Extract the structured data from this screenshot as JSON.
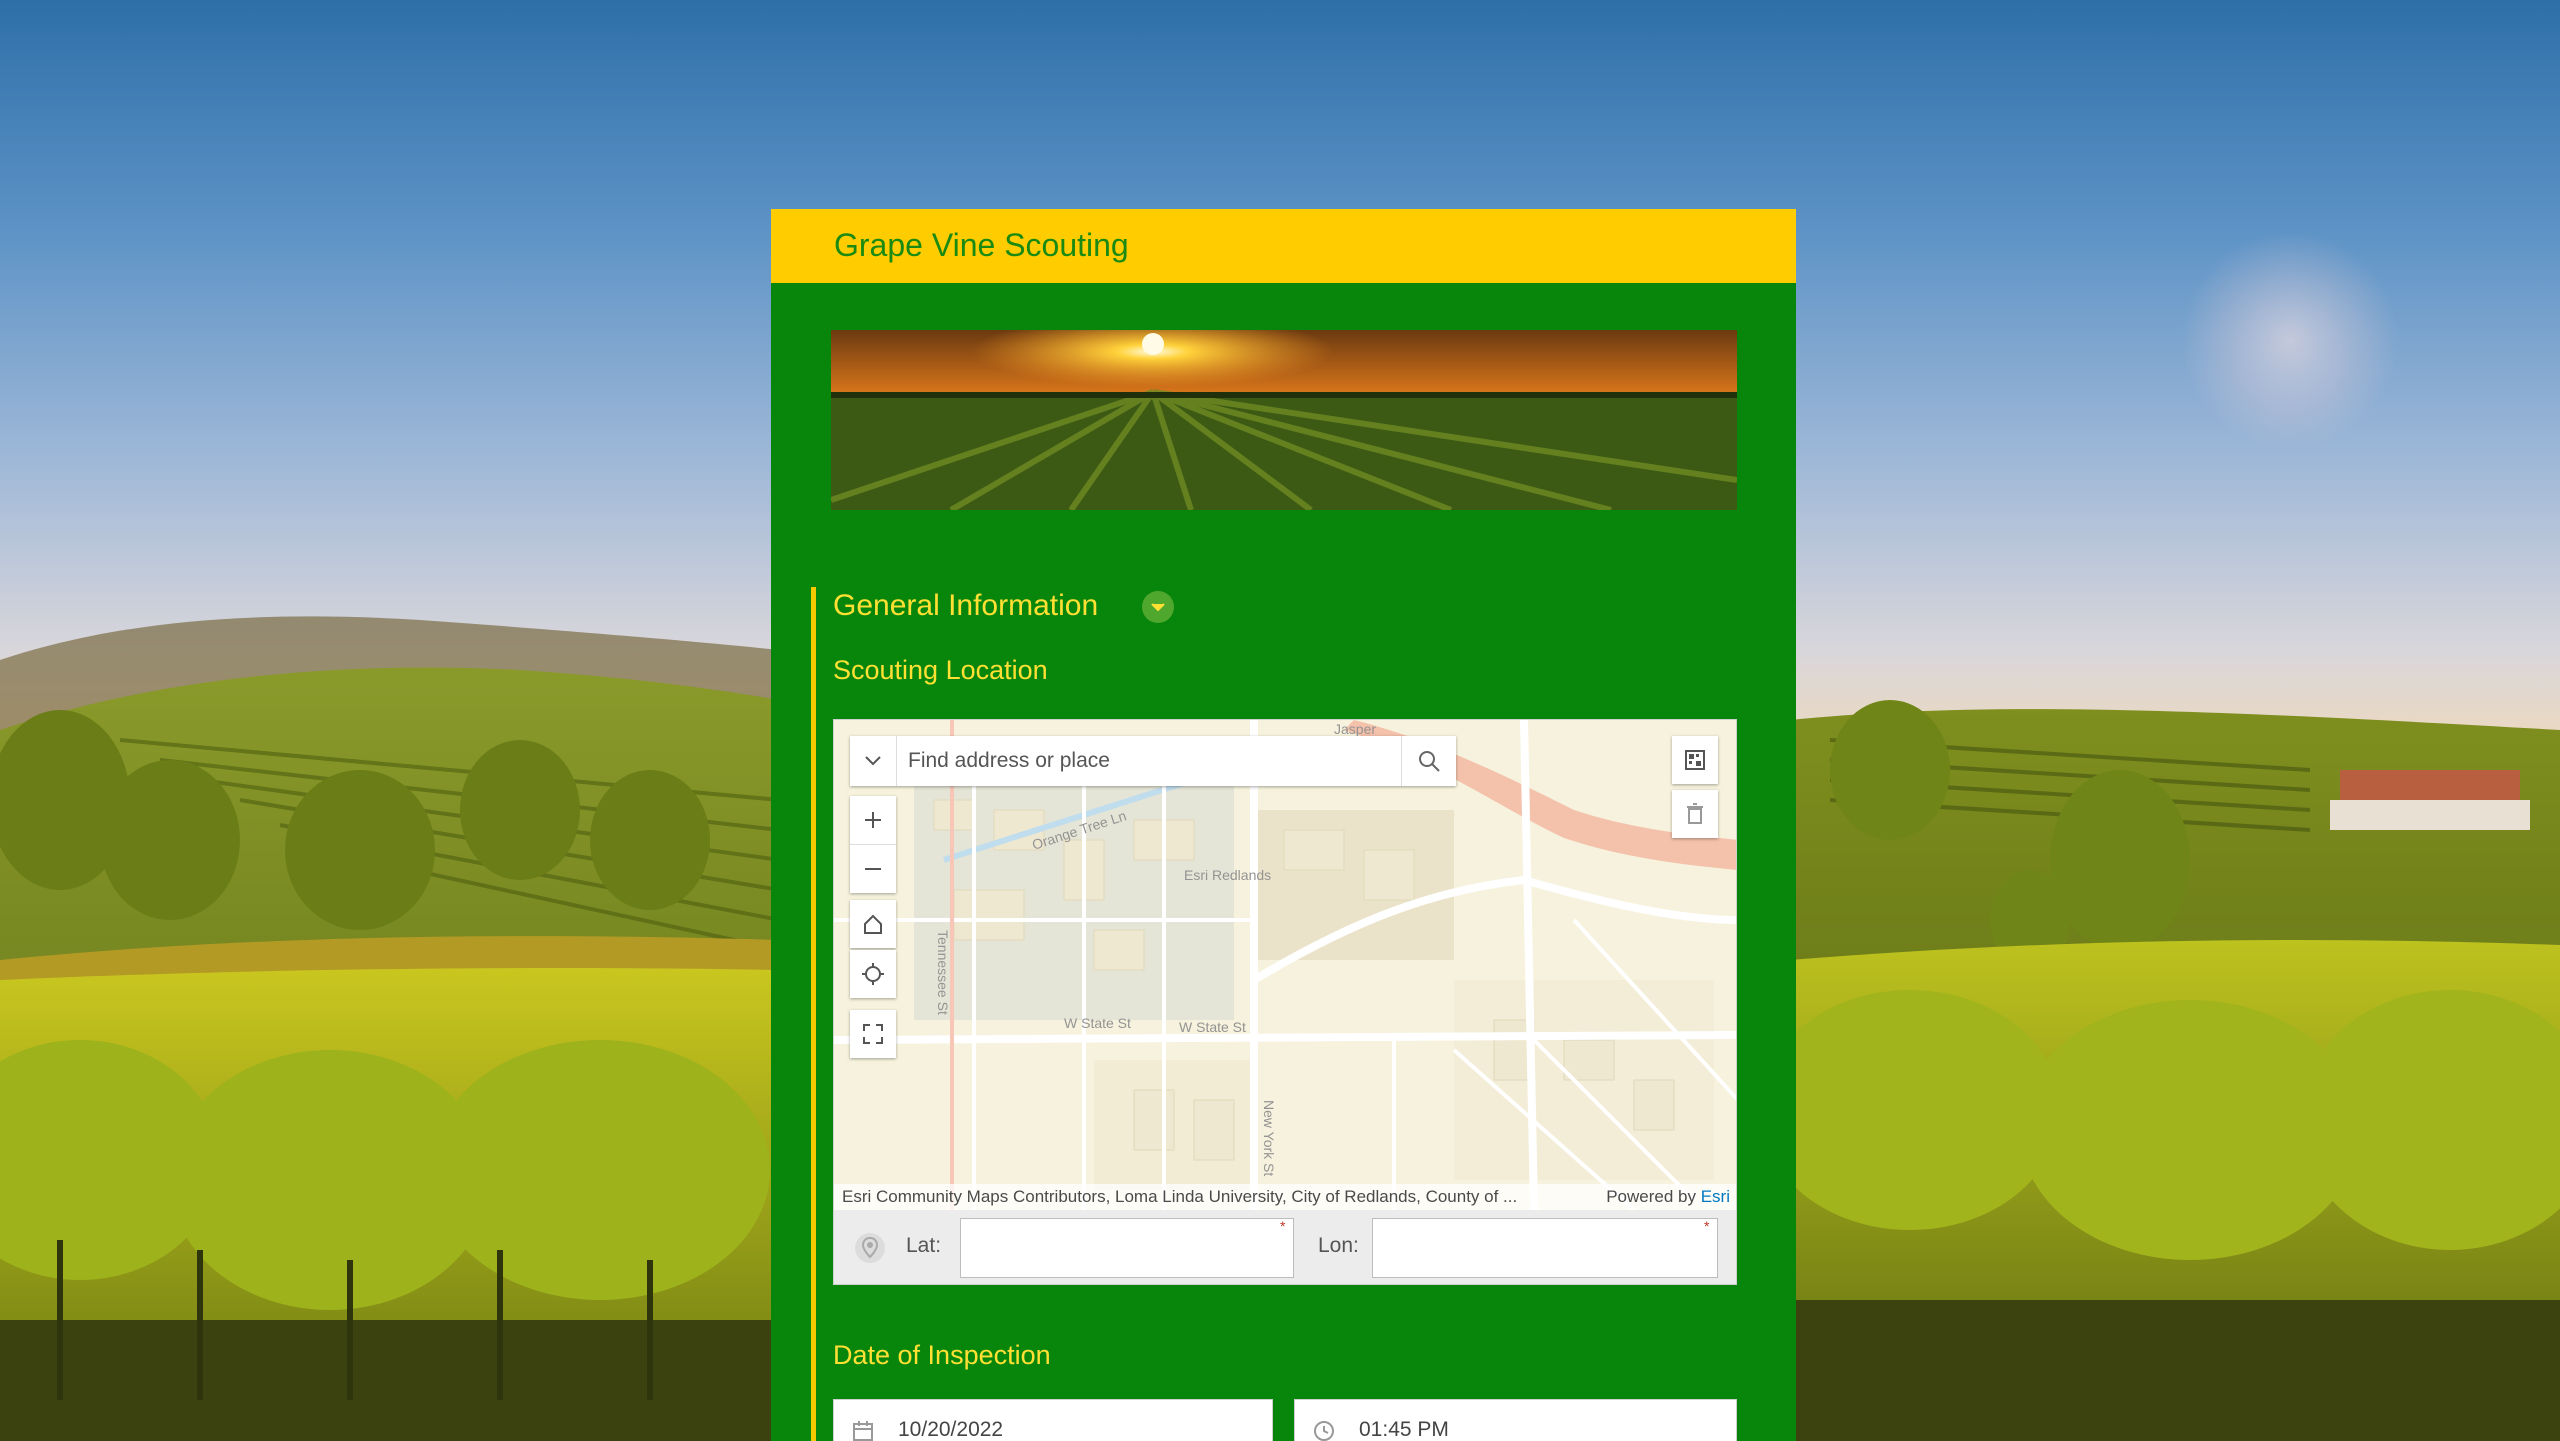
{
  "form": {
    "title": "Grape Vine Scouting",
    "group_title": "General Information",
    "scouting_location_label": "Scouting Location",
    "date_label": "Date of Inspection"
  },
  "map": {
    "search_placeholder": "Find address or place",
    "attribution": "Esri Community Maps Contributors, Loma Linda University, City of Redlands, County of ...",
    "powered_by": "Powered by",
    "esri": "Esri",
    "street_labels": [
      "Tennessee St",
      "Orange Tree Ln",
      "W State St",
      "W State St",
      "New York St",
      "Esri Redlands",
      "Jasper"
    ],
    "lat_label": "Lat:",
    "lon_label": "Lon:",
    "lat_value": "",
    "lon_value": ""
  },
  "inspection": {
    "date": "10/20/2022",
    "time": "01:45 PM"
  },
  "colors": {
    "form_green": "#08860c",
    "header_yellow": "#ffcc00",
    "label_yellow": "#ffe033",
    "title_green": "#1a8a12"
  },
  "icons": [
    "search-icon",
    "chevron-down-icon",
    "plus-icon",
    "minus-icon",
    "home-icon",
    "locate-icon",
    "fullscreen-icon",
    "qr-code-icon",
    "trash-icon",
    "location-pin-icon",
    "calendar-icon",
    "clock-icon"
  ]
}
